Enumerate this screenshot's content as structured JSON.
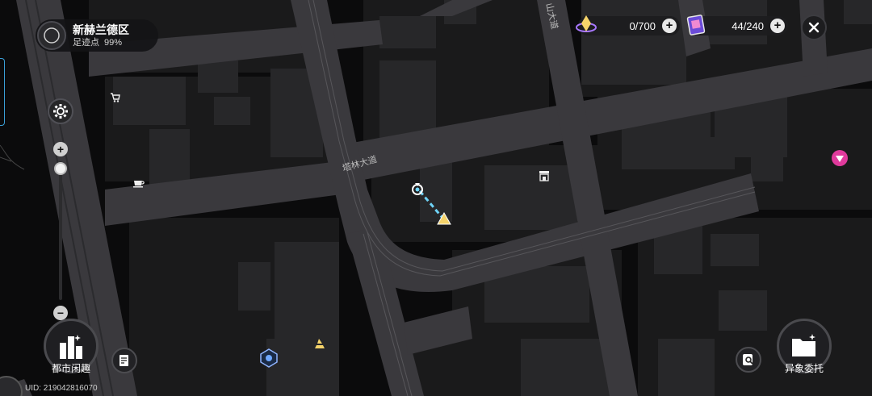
{
  "region": {
    "name": "新赫兰德区",
    "footprint_label": "足迹点",
    "footprint_value": "99%"
  },
  "resources": [
    {
      "icon": "purple-crystal-icon",
      "value": "0/700",
      "plus": "+"
    },
    {
      "icon": "card-pack-icon",
      "value": "44/240",
      "plus": "+"
    }
  ],
  "zoom": {
    "plus": "+",
    "minus": "−",
    "level": 0.02
  },
  "buttons": {
    "city_fun": "都市闲趣",
    "anomaly_commission": "异象委托"
  },
  "roads": {
    "talin_avenue": "塔林大道",
    "mountain_avenue": "山大道"
  },
  "uid": "UID: 219042816070",
  "colors": {
    "road": "#3a393d",
    "block": "#1b1b1c",
    "building": "#272729",
    "background": "#0b0b0c",
    "route": "#6fd3f7",
    "marker_yellow": "#f5d36a",
    "marker_pink": "#e03a9c"
  }
}
